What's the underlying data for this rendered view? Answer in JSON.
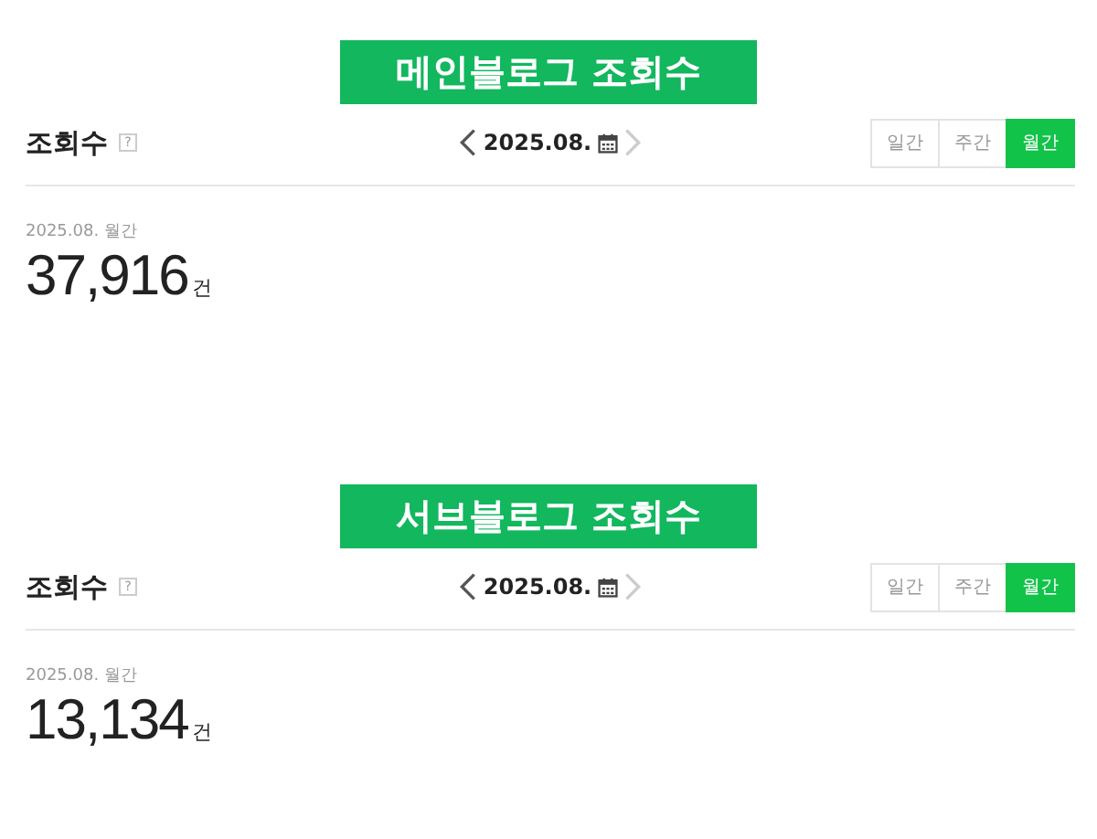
{
  "sections": [
    {
      "banner": "메인블로그 조회수",
      "title": "조회수",
      "help": "?",
      "period": "2025.08.",
      "prev_disabled": false,
      "next_disabled": true,
      "tabs": [
        {
          "label": "일간",
          "selected": false
        },
        {
          "label": "주간",
          "selected": false
        },
        {
          "label": "월간",
          "selected": true
        }
      ],
      "caption": "2025.08. 월간",
      "count": "37,916",
      "unit": "건"
    },
    {
      "banner": "서브블로그 조회수",
      "title": "조회수",
      "help": "?",
      "period": "2025.08.",
      "prev_disabled": false,
      "next_disabled": true,
      "tabs": [
        {
          "label": "일간",
          "selected": false
        },
        {
          "label": "주간",
          "selected": false
        },
        {
          "label": "월간",
          "selected": true
        }
      ],
      "caption": "2025.08. 월간",
      "count": "13,134",
      "unit": "건"
    }
  ]
}
